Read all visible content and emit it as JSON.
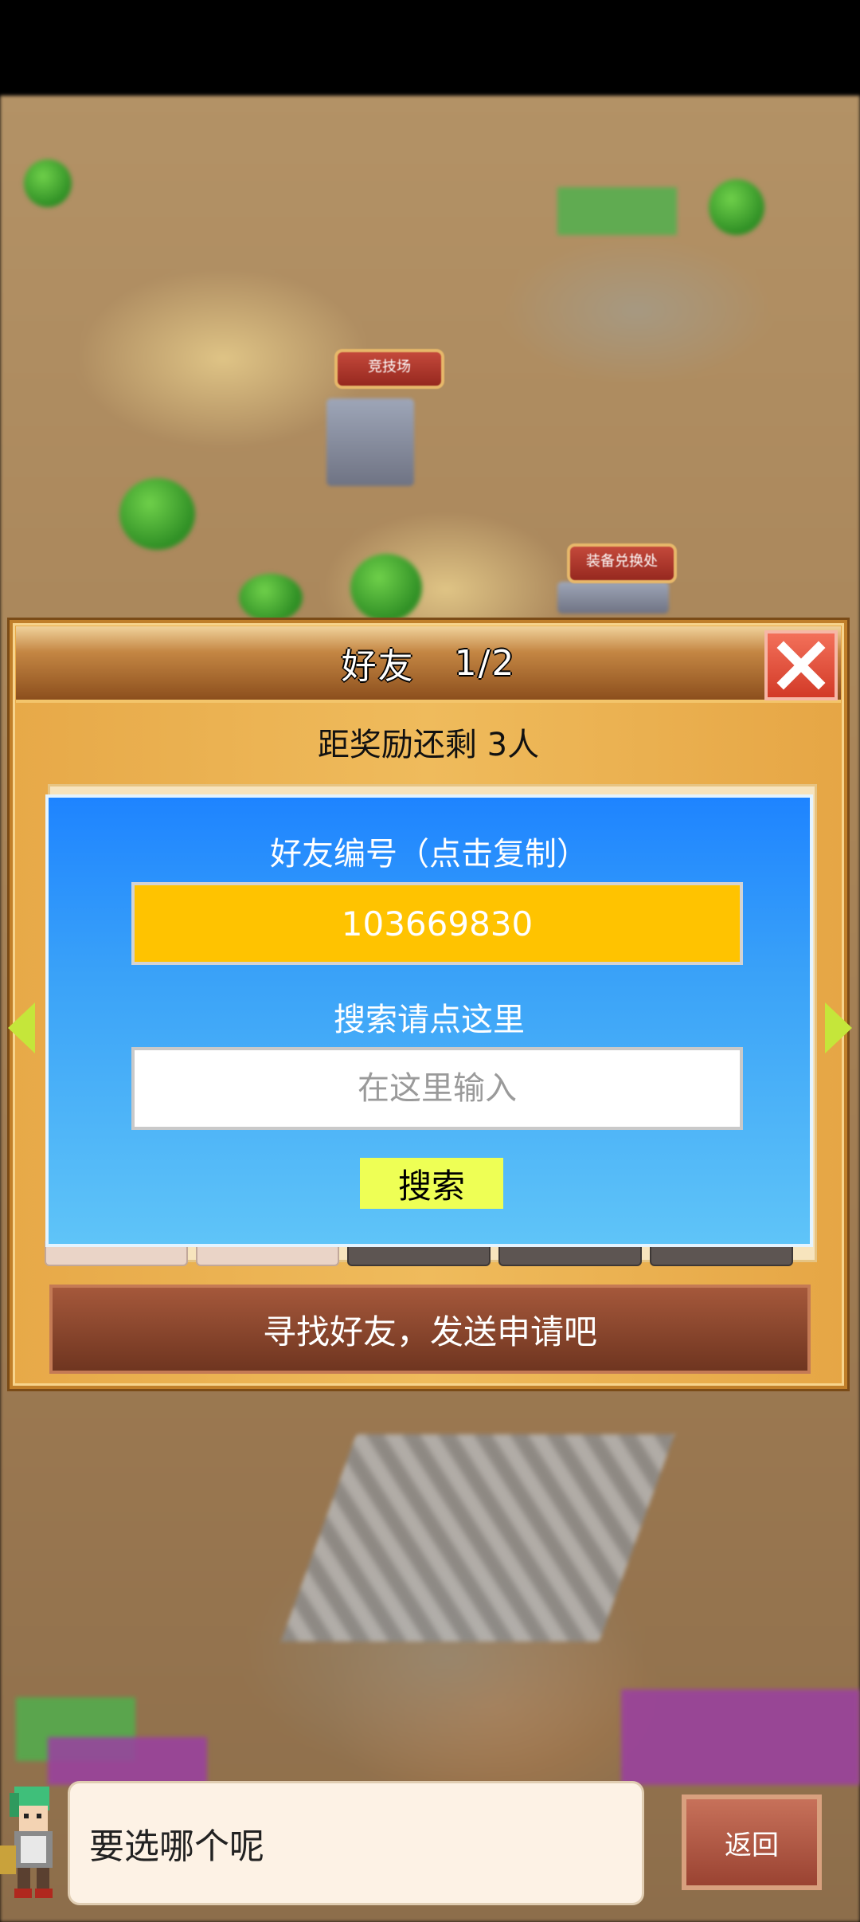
{
  "map": {
    "labels": [
      "竞技场",
      "装备兑换处"
    ]
  },
  "dialog": {
    "title": "好友",
    "page": "1/2",
    "reward_text": "距奖励还剩 3人",
    "close_icon": "close-x-icon"
  },
  "search_panel": {
    "friend_id_label": "好友编号（点击复制）",
    "friend_id_value": "103669830",
    "search_label": "搜索请点这里",
    "search_placeholder": "在这里输入",
    "search_button": "搜索"
  },
  "find_friend_bar": "寻找好友，发送申请吧",
  "bottom": {
    "speech_text": "要选哪个呢",
    "back_button": "返回"
  },
  "colors": {
    "panel_blue": "#1e84ff",
    "id_box_yellow": "#ffc300",
    "search_button_yellow": "#eeff55",
    "close_red": "#e04a35"
  }
}
